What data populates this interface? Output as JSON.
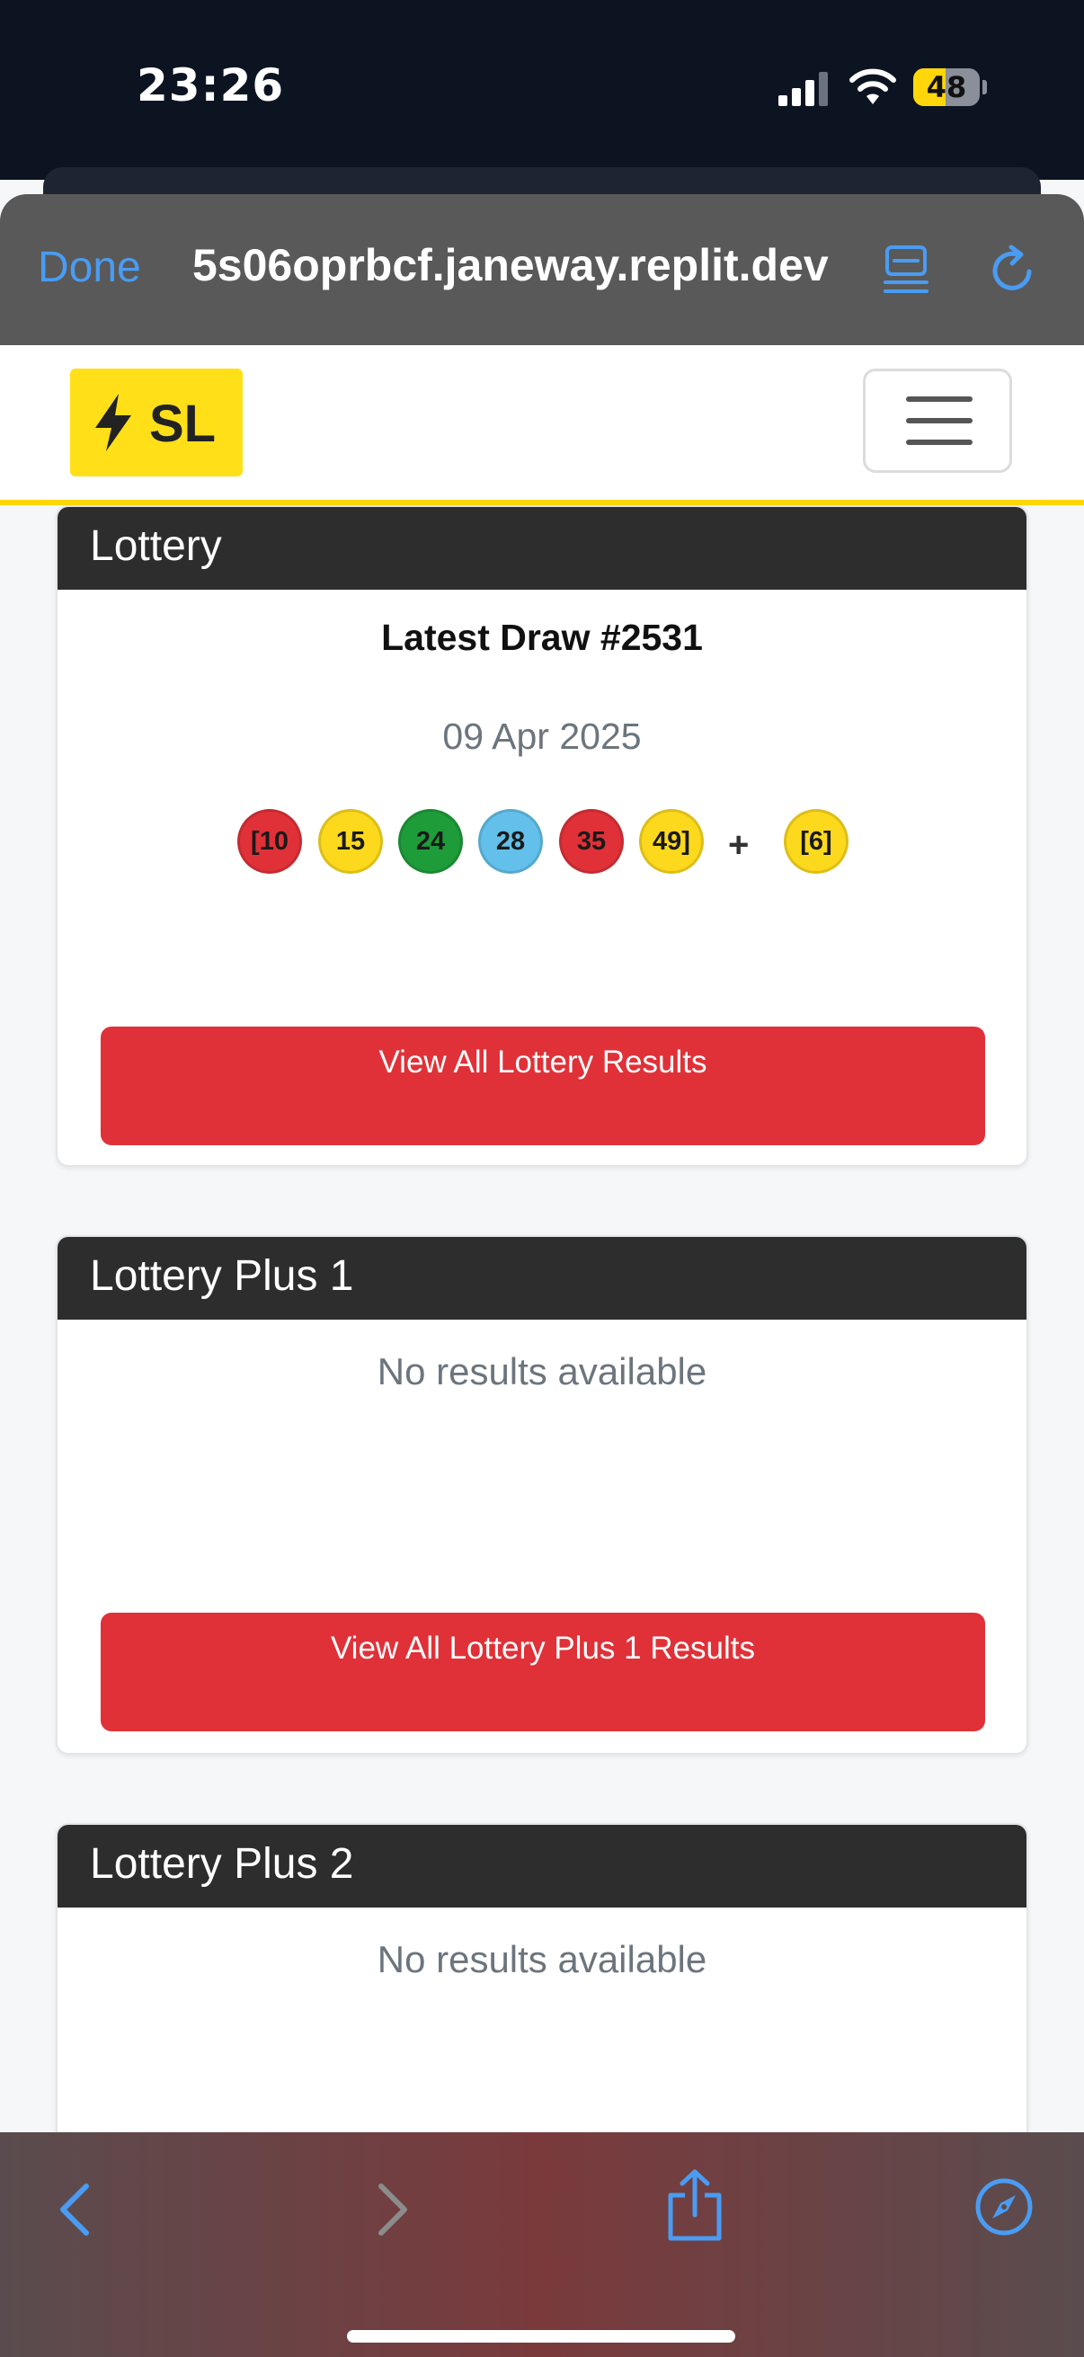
{
  "status_bar": {
    "time": "23:26",
    "battery_level": "48",
    "battery_fraction": 0.48
  },
  "browser": {
    "done_label": "Done",
    "url": "5s06oprbcf.janeway.replit.dev",
    "accent_color": "#4a9cf2"
  },
  "header": {
    "brand_text": "SL",
    "brand_color": "#ffe018"
  },
  "cards": [
    {
      "title": "Lottery",
      "draw_title": "Latest Draw #2531",
      "draw_date": "09 Apr 2025",
      "balls": [
        {
          "label": "[10",
          "color": "#e03138"
        },
        {
          "label": "15",
          "color": "#fcd91c"
        },
        {
          "label": "24",
          "color": "#1e9c3a"
        },
        {
          "label": "28",
          "color": "#62c0ea"
        },
        {
          "label": "35",
          "color": "#e03138"
        },
        {
          "label": "49]",
          "color": "#fcd91c"
        }
      ],
      "plus_sign": "+",
      "bonus_ball": {
        "label": "[6]",
        "color": "#fcd91c"
      },
      "button_label": "View All Lottery Results"
    },
    {
      "title": "Lottery Plus 1",
      "no_results": "No results available",
      "button_label": "View All Lottery Plus 1 Results"
    },
    {
      "title": "Lottery Plus 2",
      "no_results": "No results available"
    }
  ],
  "colors": {
    "button_red": "#e03138",
    "card_header": "#2d2d2d"
  },
  "icons": [
    "signal-icon",
    "wifi-icon",
    "battery-icon",
    "reader-icon",
    "reload-icon",
    "bolt-icon",
    "hamburger-menu-icon",
    "back-icon",
    "forward-icon",
    "share-icon",
    "compass-icon"
  ]
}
